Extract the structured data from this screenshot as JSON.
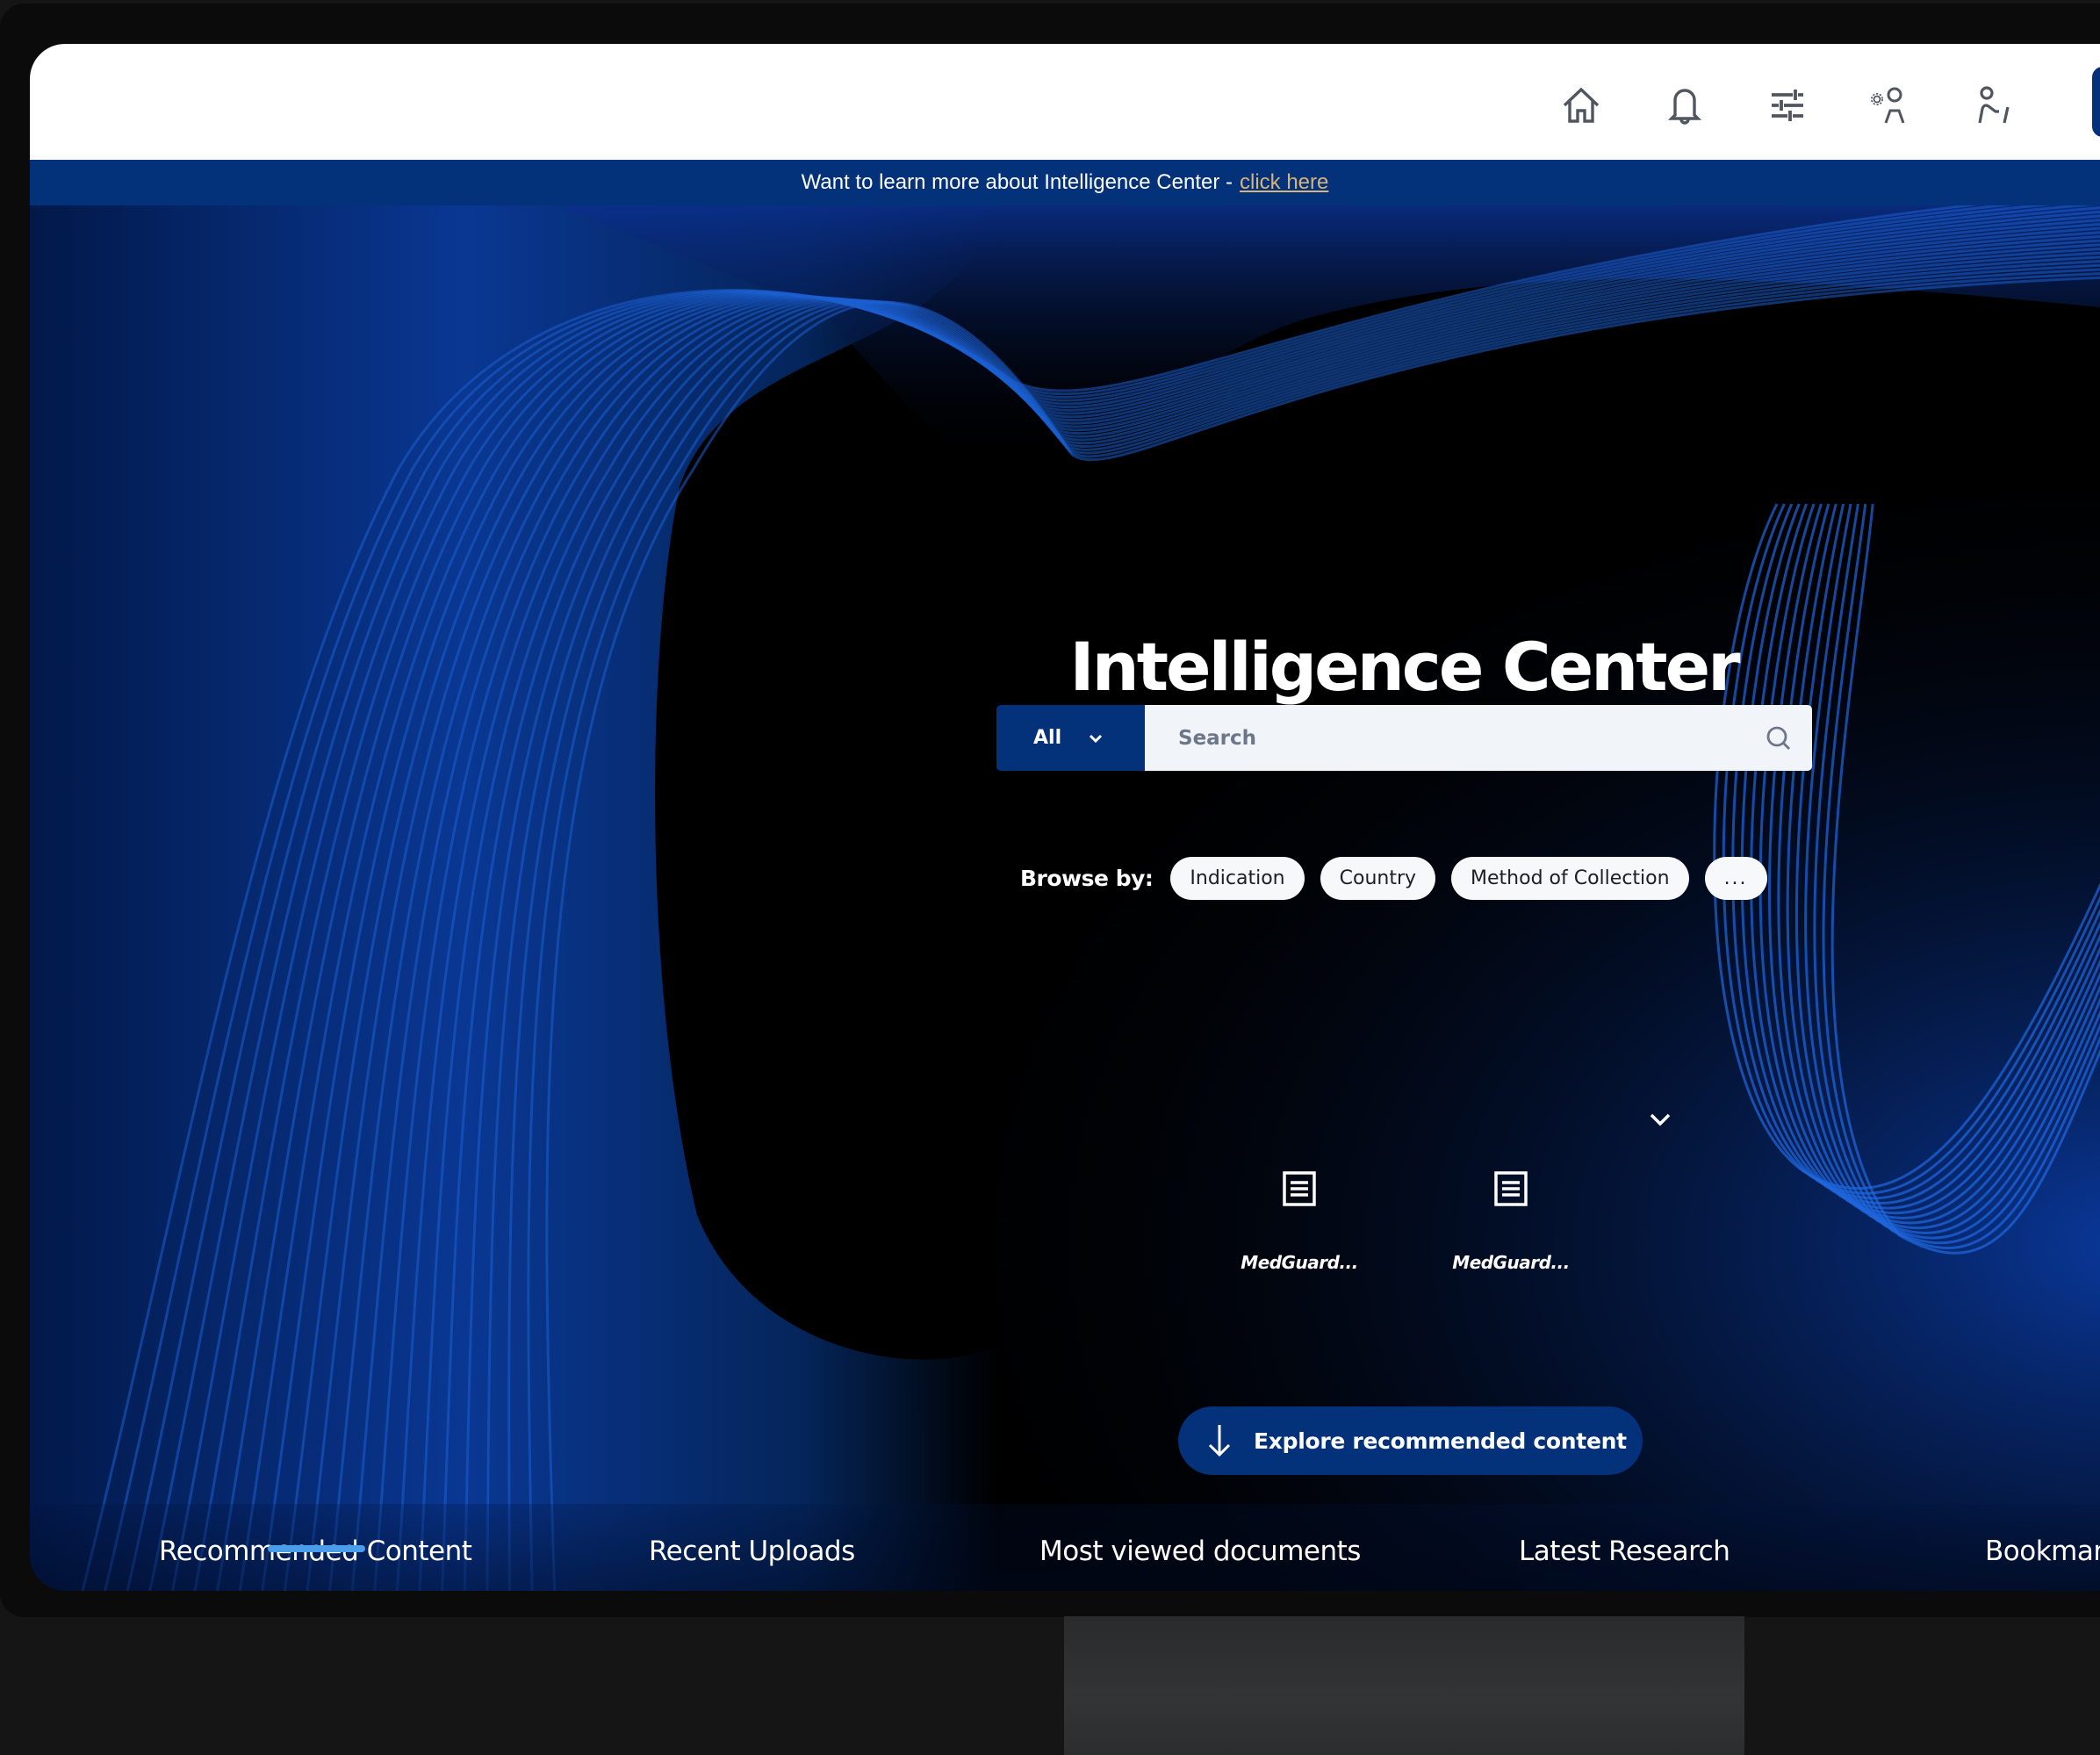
{
  "header": {
    "icons": [
      {
        "name": "home-icon",
        "label": "Home"
      },
      {
        "name": "bell-icon",
        "label": "Notifications"
      },
      {
        "name": "sliders-icon",
        "label": "Filters"
      },
      {
        "name": "user-settings-icon",
        "label": "User settings"
      },
      {
        "name": "user-edit-icon",
        "label": "Edit profile"
      }
    ]
  },
  "banner": {
    "text": "Want to learn more about Intelligence Center -",
    "link_label": "click here"
  },
  "hero": {
    "title": "Intelligence Center",
    "search": {
      "scope_selected": "All",
      "placeholder": "Search",
      "value": ""
    },
    "browse": {
      "label": "Browse by:",
      "chips": [
        "Indication",
        "Country",
        "Method of Collection",
        "..."
      ]
    },
    "documents": [
      {
        "title": "MedGuard...",
        "icon": "document-icon"
      },
      {
        "title": "MedGuard...",
        "icon": "document-icon"
      }
    ],
    "explore_button": "Explore recommended content"
  },
  "tabs": {
    "active": "Recommended Content",
    "items": [
      "Recommended Content",
      "Recent Uploads",
      "Most viewed documents",
      "Latest Research",
      "Bookmarks"
    ]
  },
  "colors": {
    "brand_navy": "#03317a",
    "link_gold": "#d7b47a",
    "tab_underline": "#4a9de8",
    "search_bg": "#f1f4f8"
  }
}
